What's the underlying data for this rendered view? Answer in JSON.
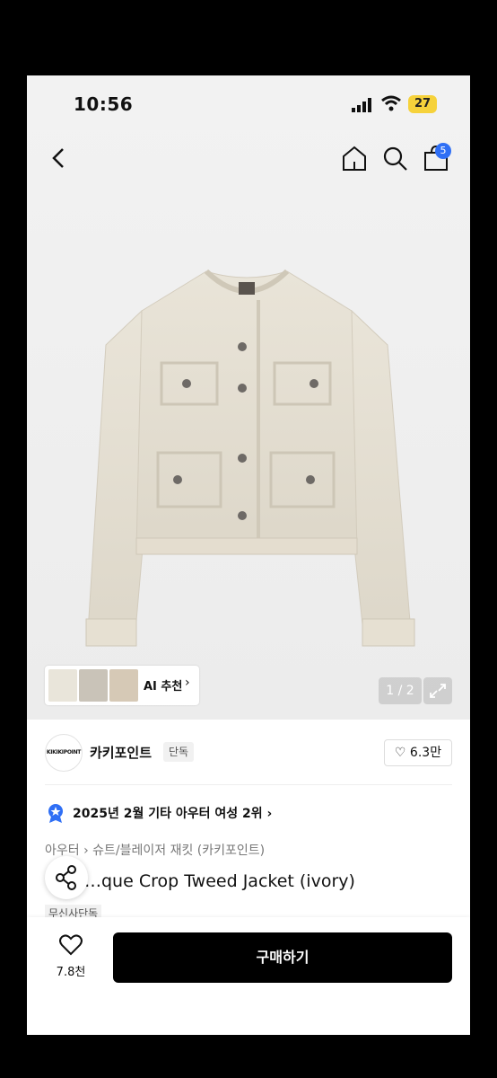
{
  "status_bar": {
    "time": "10:56",
    "battery": "27"
  },
  "header": {
    "back_icon": "chevron-left-icon",
    "home_icon": "home-icon",
    "search_icon": "search-icon",
    "cart_icon": "bag-icon",
    "cart_count": "5"
  },
  "gallery": {
    "ai_label": "AI 추천",
    "ai_chevron": "›",
    "page_indicator": "1 / 2",
    "expand_icon": "expand-icon"
  },
  "brand": {
    "logo_text": "KIKIKIPOINT",
    "name": "카키포인트",
    "tag": "단독",
    "like_label": "♡ 6.3만"
  },
  "ranking": {
    "badge_icon": "medal-icon",
    "text": "2025년 2월 기타 아우터 여성 2위 ›"
  },
  "product": {
    "breadcrumb": "아우터 › 슈트/블레이저 재킷 (카키포인트)",
    "title": "…que Crop Tweed Jacket (ivory)",
    "exclusive_tag": "무신사단독"
  },
  "bottom": {
    "heart_icon": "heart-icon",
    "like_count": "7.8천",
    "buy_label": "구매하기"
  },
  "colors": {
    "accent": "#2f6ff5",
    "battery": "#f6d23b",
    "buy_button": "#000000"
  }
}
